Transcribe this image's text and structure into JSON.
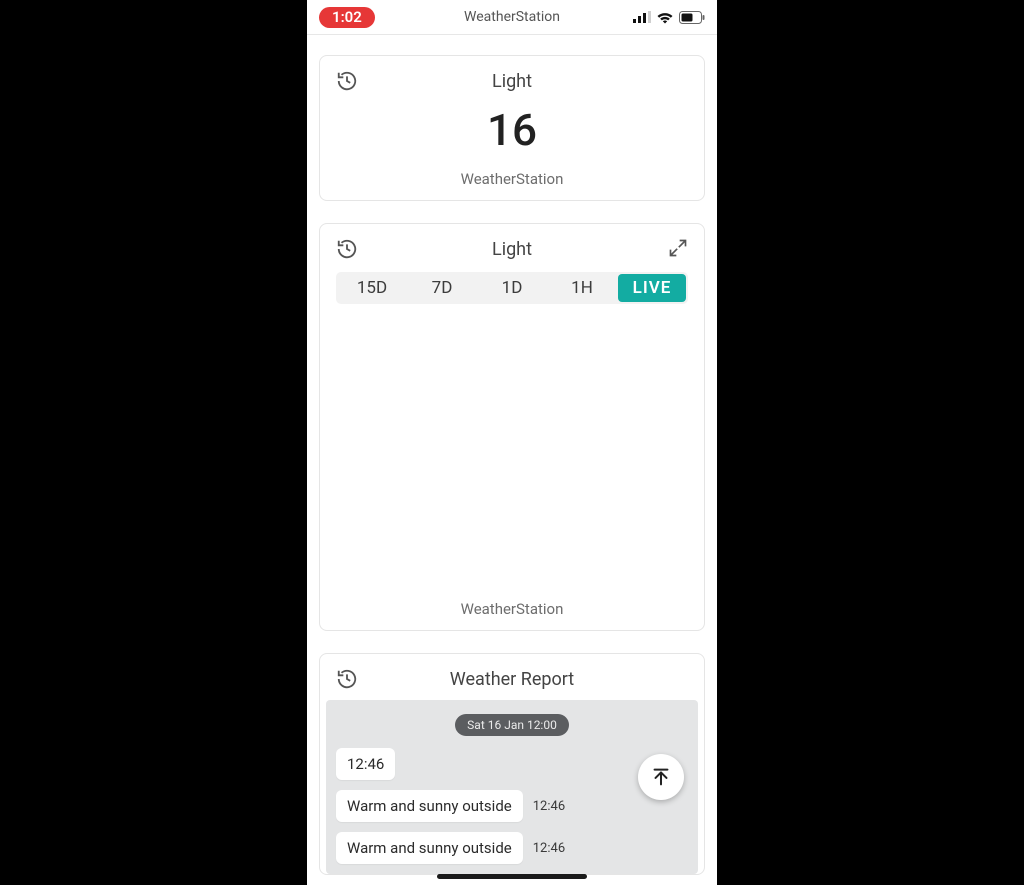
{
  "statusbar": {
    "time": "1:02",
    "app_title": "WeatherStation"
  },
  "card_light_value": {
    "title": "Light",
    "value": "16",
    "station": "WeatherStation"
  },
  "card_light_graph": {
    "title": "Light",
    "ranges": [
      "15D",
      "7D",
      "1D",
      "1H",
      "LIVE"
    ],
    "active_range_index": 4,
    "station": "WeatherStation"
  },
  "card_report": {
    "title": "Weather Report",
    "date_header": "Sat 16 Jan 12:00",
    "messages": [
      {
        "text": "12:46",
        "time": ""
      },
      {
        "text": "Warm and sunny outside",
        "time": "12:46"
      },
      {
        "text": "Warm and sunny outside",
        "time": "12:46"
      }
    ]
  },
  "chart_data": {
    "type": "line",
    "title": "Light",
    "series": [],
    "note": "No data points rendered in visible area",
    "range_selected": "LIVE"
  }
}
